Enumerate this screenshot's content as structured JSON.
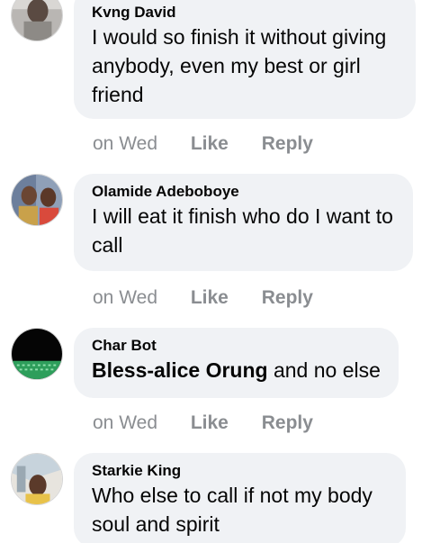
{
  "comments": [
    {
      "author": "Kvng David",
      "text": "I would so finish it without giving anybody, even my best or girl friend",
      "time": "on Wed",
      "like": "Like",
      "reply": "Reply"
    },
    {
      "author": "Olamide Adeboboye",
      "text": "I  will eat it finish who do I want to call",
      "time": "on Wed",
      "like": "Like",
      "reply": "Reply"
    },
    {
      "author": "Char Bot",
      "mention": "Bless-alice Orung",
      "text": " and no else",
      "time": "on Wed",
      "like": "Like",
      "reply": "Reply"
    },
    {
      "author": "Starkie King",
      "text": "Who else to call if not my body soul and spirit"
    }
  ],
  "colors": {
    "bubble": "#f0f2f5",
    "meta_text": "#8a8d91",
    "body_text": "#050505"
  }
}
